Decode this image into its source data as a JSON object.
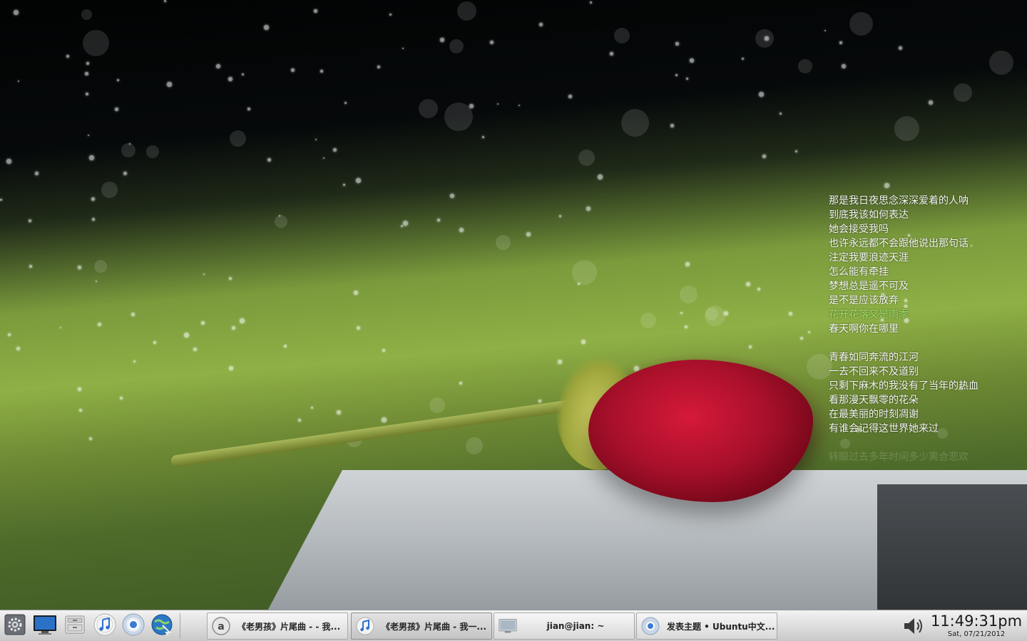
{
  "lyrics": {
    "lines": [
      "那是我日夜思念深深爱着的人呐",
      "到底我该如何表达",
      "她会接受我吗",
      "也许永远都不会跟他说出那句话",
      "注定我要浪迹天涯",
      "怎么能有牵挂",
      "梦想总是遥不可及",
      "是不是应该放弃",
      "花开花落又是雨季",
      "春天啊你在哪里",
      "",
      "青春如同奔流的江河",
      "一去不回来不及道别",
      "只剩下麻木的我没有了当年的热血",
      "看那漫天飘零的花朵",
      "在最美丽的时刻凋谢",
      "有谁会记得这世界她来过",
      "",
      "转眼过去多年时间多少离合悲欢"
    ],
    "current_color": "#9fe06a"
  },
  "taskbar": {
    "launchers": [
      {
        "name": "system-settings",
        "icon": "gear-icon"
      },
      {
        "name": "show-desktop",
        "icon": "monitor-icon"
      },
      {
        "name": "file-manager",
        "icon": "file-cabinet-icon"
      },
      {
        "name": "music-player",
        "icon": "music-note-icon"
      },
      {
        "name": "chrome-browser",
        "icon": "chrome-icon"
      },
      {
        "name": "web-browser",
        "icon": "globe-icon"
      }
    ],
    "tasks": [
      {
        "label": "《老男孩》片尾曲 - - 我...",
        "icon": "at-sign-icon"
      },
      {
        "label": "《老男孩》片尾曲 - 我一...",
        "icon": "music-note-icon"
      },
      {
        "label": "jian@jian: ~",
        "icon": "terminal-icon"
      },
      {
        "label": "发表主题 • Ubuntu中文...",
        "icon": "chrome-icon"
      }
    ],
    "clock": {
      "time": "11:49:31pm",
      "date": "Sat, 07/21/2012"
    }
  }
}
